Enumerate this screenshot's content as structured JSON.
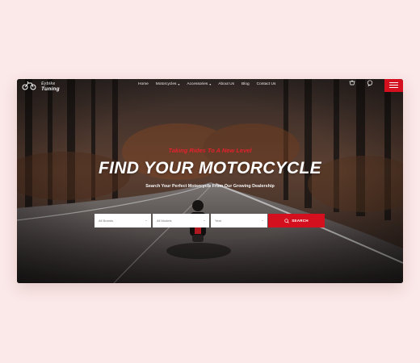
{
  "brand": {
    "line1": "Eybike",
    "line2": "Tuning"
  },
  "nav": {
    "items": [
      {
        "label": "Home",
        "has_dropdown": false
      },
      {
        "label": "Motorcycles",
        "has_dropdown": true
      },
      {
        "label": "Accessories",
        "has_dropdown": true
      },
      {
        "label": "About Us",
        "has_dropdown": false
      },
      {
        "label": "Blog",
        "has_dropdown": false
      },
      {
        "label": "Contact Us",
        "has_dropdown": false
      }
    ],
    "tools": [
      "cart-icon",
      "chat-icon",
      "menu-icon"
    ]
  },
  "hero": {
    "tagline": "Taking Rides To A New Level",
    "headline": "FIND YOUR MOTORCYCLE",
    "subhead": "Search Your Perfect Motorcycle From Our Growing Dealership"
  },
  "search": {
    "brand_select": "All Brands",
    "model_select": "All Models",
    "year_select": "Year",
    "button_label": "SEARCH"
  },
  "colors": {
    "accent": "#d4101e",
    "page_bg": "#fbe8e8"
  }
}
